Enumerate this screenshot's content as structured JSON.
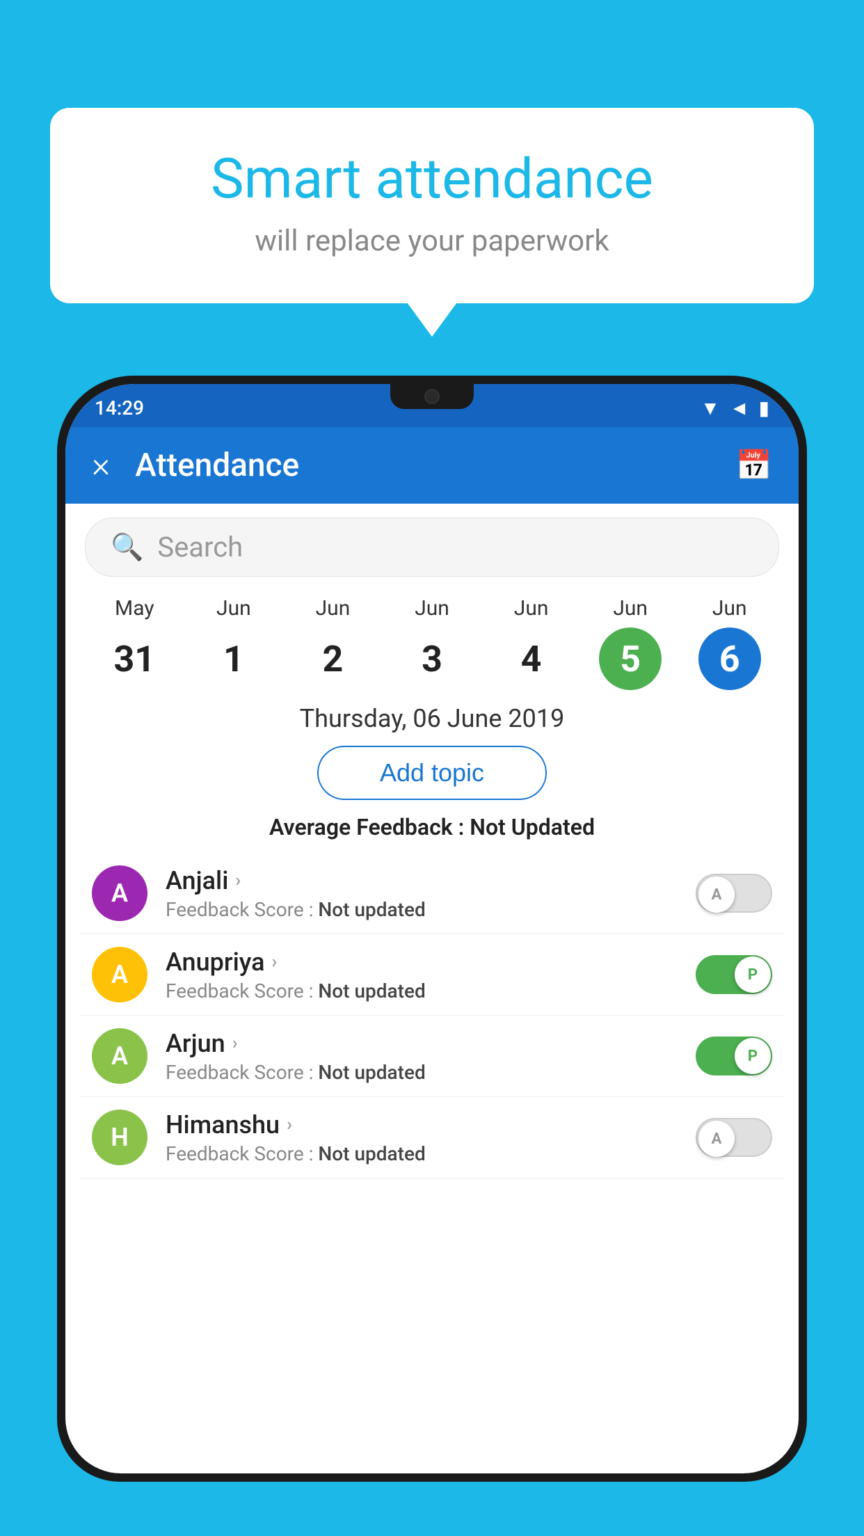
{
  "background_color": "#1BB8E8",
  "bubble": {
    "title": "Smart attendance",
    "subtitle": "will replace your paperwork"
  },
  "status_bar": {
    "time": "14:29",
    "icons": [
      "wifi",
      "signal",
      "battery"
    ]
  },
  "app_bar": {
    "title": "Attendance",
    "close_label": "×",
    "calendar_icon": "📅"
  },
  "search": {
    "placeholder": "Search"
  },
  "calendar": {
    "days": [
      {
        "month": "May",
        "day": "31",
        "style": "normal"
      },
      {
        "month": "Jun",
        "day": "1",
        "style": "normal"
      },
      {
        "month": "Jun",
        "day": "2",
        "style": "normal"
      },
      {
        "month": "Jun",
        "day": "3",
        "style": "normal"
      },
      {
        "month": "Jun",
        "day": "4",
        "style": "normal"
      },
      {
        "month": "Jun",
        "day": "5",
        "style": "green"
      },
      {
        "month": "Jun",
        "day": "6",
        "style": "blue"
      }
    ]
  },
  "selected_date": "Thursday, 06 June 2019",
  "add_topic_label": "Add topic",
  "avg_feedback_label": "Average Feedback :",
  "avg_feedback_value": "Not Updated",
  "students": [
    {
      "name": "Anjali",
      "avatar_letter": "A",
      "avatar_color": "#9C27B0",
      "feedback": "Feedback Score : Not updated",
      "toggle": "off",
      "toggle_letter": "A"
    },
    {
      "name": "Anupriya",
      "avatar_letter": "A",
      "avatar_color": "#FFC107",
      "feedback": "Feedback Score : Not updated",
      "toggle": "on",
      "toggle_letter": "P"
    },
    {
      "name": "Arjun",
      "avatar_letter": "A",
      "avatar_color": "#8BC34A",
      "feedback": "Feedback Score : Not updated",
      "toggle": "on",
      "toggle_letter": "P"
    },
    {
      "name": "Himanshu",
      "avatar_letter": "H",
      "avatar_color": "#8BC34A",
      "feedback": "Feedback Score : Not updated",
      "toggle": "off",
      "toggle_letter": "A"
    }
  ]
}
